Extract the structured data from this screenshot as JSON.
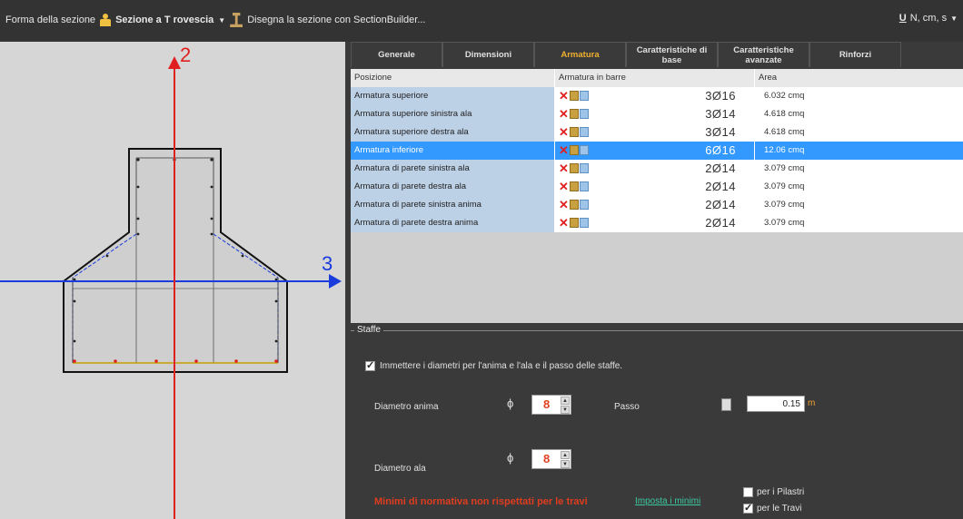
{
  "toolbar": {
    "section_shape_label": "Forma della sezione",
    "section_type": "Sezione a T rovescia",
    "section_builder": "Disegna la sezione con SectionBuilder...",
    "units": "N, cm, s",
    "units_prefix": "U"
  },
  "drawing": {
    "axis_vertical_label": "2",
    "axis_horizontal_label": "3"
  },
  "tabs": [
    {
      "label": "Generale"
    },
    {
      "label": "Dimensioni"
    },
    {
      "label": "Armatura"
    },
    {
      "label": "Caratteristiche di base"
    },
    {
      "label": "Caratteristiche avanzate"
    },
    {
      "label": "Rinforzi"
    }
  ],
  "active_tab": "Armatura",
  "grid": {
    "headers": [
      "Posizione",
      "Armatura in barre",
      "Area"
    ],
    "rows": [
      {
        "position": "Armatura superiore",
        "bars": "3Ø16",
        "area": "6.032 cmq"
      },
      {
        "position": "Armatura superiore sinistra ala",
        "bars": "3Ø14",
        "area": "4.618 cmq"
      },
      {
        "position": "Armatura superiore destra ala",
        "bars": "3Ø14",
        "area": "4.618 cmq"
      },
      {
        "position": "Armatura inferiore",
        "bars": "6Ø16",
        "area": "12.06 cmq"
      },
      {
        "position": "Armatura di parete sinistra ala",
        "bars": "2Ø14",
        "area": "3.079 cmq"
      },
      {
        "position": "Armatura di parete destra ala",
        "bars": "2Ø14",
        "area": "3.079 cmq"
      },
      {
        "position": "Armatura di parete sinistra anima",
        "bars": "2Ø14",
        "area": "3.079 cmq"
      },
      {
        "position": "Armatura di parete destra anima",
        "bars": "2Ø14",
        "area": "3.079 cmq"
      }
    ],
    "selected_row": 3
  },
  "stirrups": {
    "title": "Staffe",
    "enter_diameters_label": "Immettere i diametri per l'anima e l'ala e il passo delle staffe.",
    "enter_diameters_checked": true,
    "web_diameter_label": "Diametro anima",
    "web_diameter_value": "8",
    "flange_diameter_label": "Diametro ala",
    "flange_diameter_value": "8",
    "phi_symbol": "ϕ",
    "spacing_label": "Passo",
    "spacing_value": "0.15",
    "spacing_unit": "m",
    "warning": "Minimi di normativa non rispettati per le travi",
    "set_minimums_link": "Imposta i minimi",
    "for_columns_label": "per i Pilastri",
    "for_columns_checked": false,
    "for_beams_label": "per le Travi",
    "for_beams_checked": true
  },
  "colors": {
    "axis_vertical": "#e02020",
    "axis_horizontal": "#1a3cdc",
    "selected_row": "#3399ff",
    "active_tab": "#f0b030",
    "warning": "#e03c1e",
    "link": "#3cc8a0"
  }
}
